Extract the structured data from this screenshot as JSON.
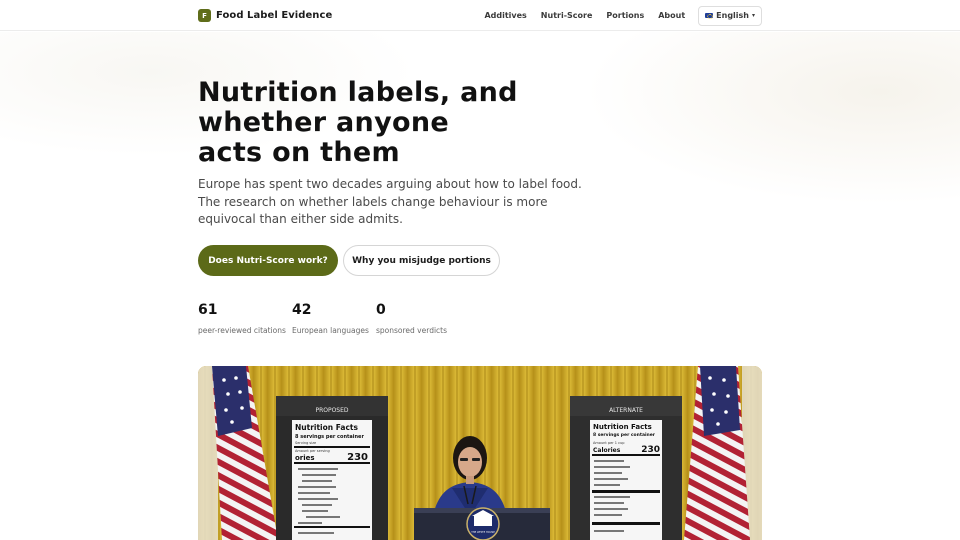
{
  "header": {
    "brand_badge": "F",
    "brand_name": "Food Label Evidence",
    "nav": [
      {
        "label": "Additives"
      },
      {
        "label": "Nutri-Score"
      },
      {
        "label": "Portions"
      },
      {
        "label": "About"
      }
    ],
    "language": {
      "label": "English",
      "flag": "eu-flag-icon",
      "caret": "▾"
    }
  },
  "hero": {
    "title_lines": [
      "Nutrition labels, and",
      "whether anyone",
      "acts on them"
    ],
    "lede": "Europe has spent two decades arguing about how to label food. The research on whether labels change behaviour is more equivocal than either side admits.",
    "primary_cta": "Does Nutri-Score work?",
    "secondary_cta": "Why you misjudge portions"
  },
  "stats": [
    {
      "value": "61",
      "label": "peer-reviewed citations"
    },
    {
      "value": "42",
      "label": "European languages"
    },
    {
      "value": "0",
      "label": "sponsored verdicts"
    }
  ],
  "photo": {
    "left_board": {
      "header": "PROPOSED",
      "title": "Nutrition Facts",
      "servings": "8 servings per container",
      "serving_size_label": "Serving size",
      "amount_label": "Amount per serving",
      "calories_label": "ories",
      "calories": "230"
    },
    "right_board": {
      "header": "ALTERNATE",
      "title": "Nutrition Facts",
      "servings": "8 servings per container",
      "amount_label": "Amount per 1 cup",
      "calories_label": "Calories",
      "calories": "230"
    },
    "podium_seal": "THE WHITE HOUSE"
  }
}
